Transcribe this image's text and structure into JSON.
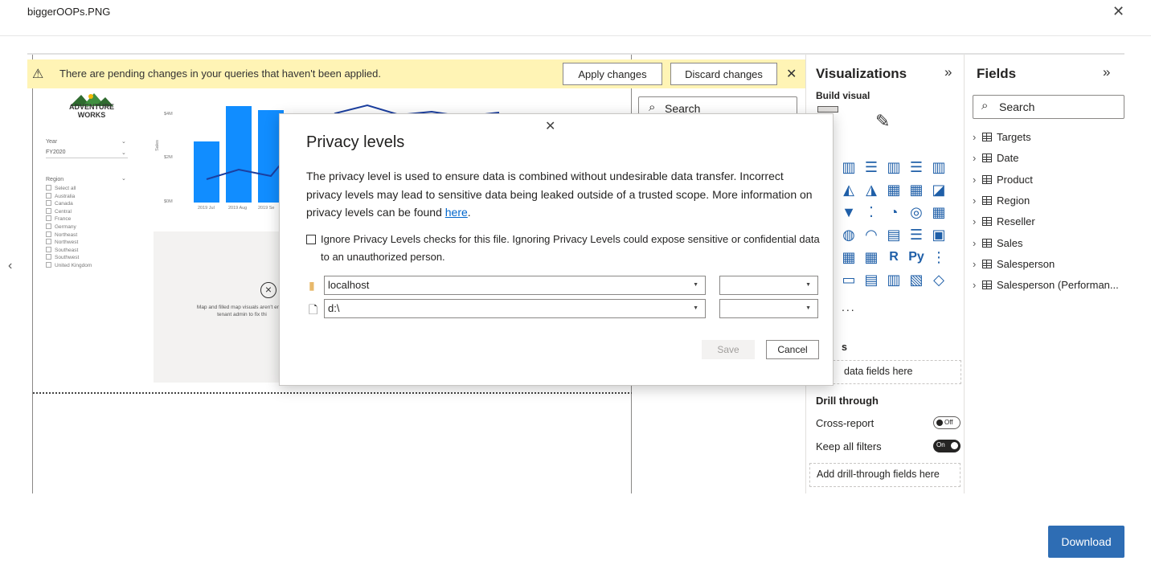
{
  "viewer": {
    "filename": "biggerOOPs.PNG",
    "download_label": "Download"
  },
  "banner": {
    "message": "There are pending changes in your queries that haven't been applied.",
    "apply_label": "Apply changes",
    "discard_label": "Discard changes"
  },
  "report": {
    "logo_line1": "Adventure",
    "logo_line2": "Works",
    "year_label": "Year",
    "year_value": "FY2020",
    "region_label": "Region",
    "regions": [
      "Select all",
      "Australia",
      "Canada",
      "Central",
      "France",
      "Germany",
      "Northeast",
      "Northwest",
      "Southeast",
      "Southwest",
      "United Kingdom"
    ],
    "y_ticks": [
      "$4M",
      "$2M",
      "$0M"
    ],
    "y_axis_label": "Sales",
    "x_ticks": [
      "2019 Jul",
      "2019 Aug",
      "2019 Se"
    ],
    "map_message_line1": "Map and filled map visuals aren't enabl",
    "map_message_line2": "tenant admin to fix thi",
    "accent_color": "#118dff"
  },
  "filters": {
    "search_placeholder": "Search"
  },
  "visualizations": {
    "title": "Visualizations",
    "build_visual_label": "Build visual",
    "more_label": "...",
    "values_label_partial": "s",
    "add_data_label": "data fields here",
    "drill_through_label": "Drill through",
    "cross_report_label": "Cross-report",
    "cross_report_state": "Off",
    "keep_filters_label": "Keep all filters",
    "keep_filters_state": "On",
    "add_drill_label": "Add drill-through fields here"
  },
  "fields": {
    "title": "Fields",
    "search_placeholder": "Search",
    "items": [
      "Targets",
      "Date",
      "Product",
      "Region",
      "Reseller",
      "Sales",
      "Salesperson",
      "Salesperson (Performan..."
    ]
  },
  "dialog": {
    "title": "Privacy levels",
    "body": "The privacy level is used to ensure data is combined without undesirable data transfer. Incorrect privacy levels may lead to sensitive data being leaked outside of a trusted scope. More information on privacy levels can be found ",
    "link_text": "here",
    "body_end": ".",
    "ignore_checkbox_label": "Ignore Privacy Levels checks for this file. Ignoring Privacy Levels could expose sensitive or confidential data to an unauthorized person.",
    "sources": [
      {
        "name": "localhost",
        "level": ""
      },
      {
        "name": "d:\\",
        "level": ""
      }
    ],
    "save_label": "Save",
    "cancel_label": "Cancel"
  }
}
